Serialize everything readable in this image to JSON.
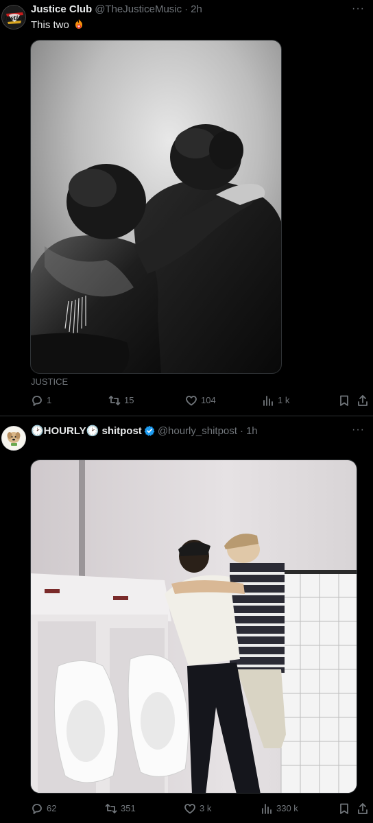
{
  "tweets": [
    {
      "author": "Justice Club",
      "handle": "@TheJusticeMusic",
      "time": "2h",
      "text": "This two",
      "emoji": "fire-heart-icon",
      "media_alt": "Black and white photo of two curly-haired people in leather jackets, arms around each other on stage",
      "source": "JUSTICE",
      "stats": {
        "replies": "1",
        "reposts": "15",
        "likes": "104",
        "views": "1 k"
      },
      "avatar_label": "Justice"
    },
    {
      "author": "🕑HOURLY🕑 shitpost",
      "handle": "@hourly_shitpost",
      "time": "1h",
      "verified": true,
      "media_alt": "Photo of two men with arms around each other standing at urinals in a tiled bathroom",
      "stats": {
        "replies": "62",
        "reposts": "351",
        "likes": "3 k",
        "views": "330 k"
      }
    }
  ],
  "ui": {
    "dot": "·",
    "more": "···"
  },
  "colors": {
    "background": "#000000",
    "text": "#e7e9ea",
    "muted": "#71767b",
    "divider": "#2f3336",
    "verified": "#1d9bf0"
  }
}
